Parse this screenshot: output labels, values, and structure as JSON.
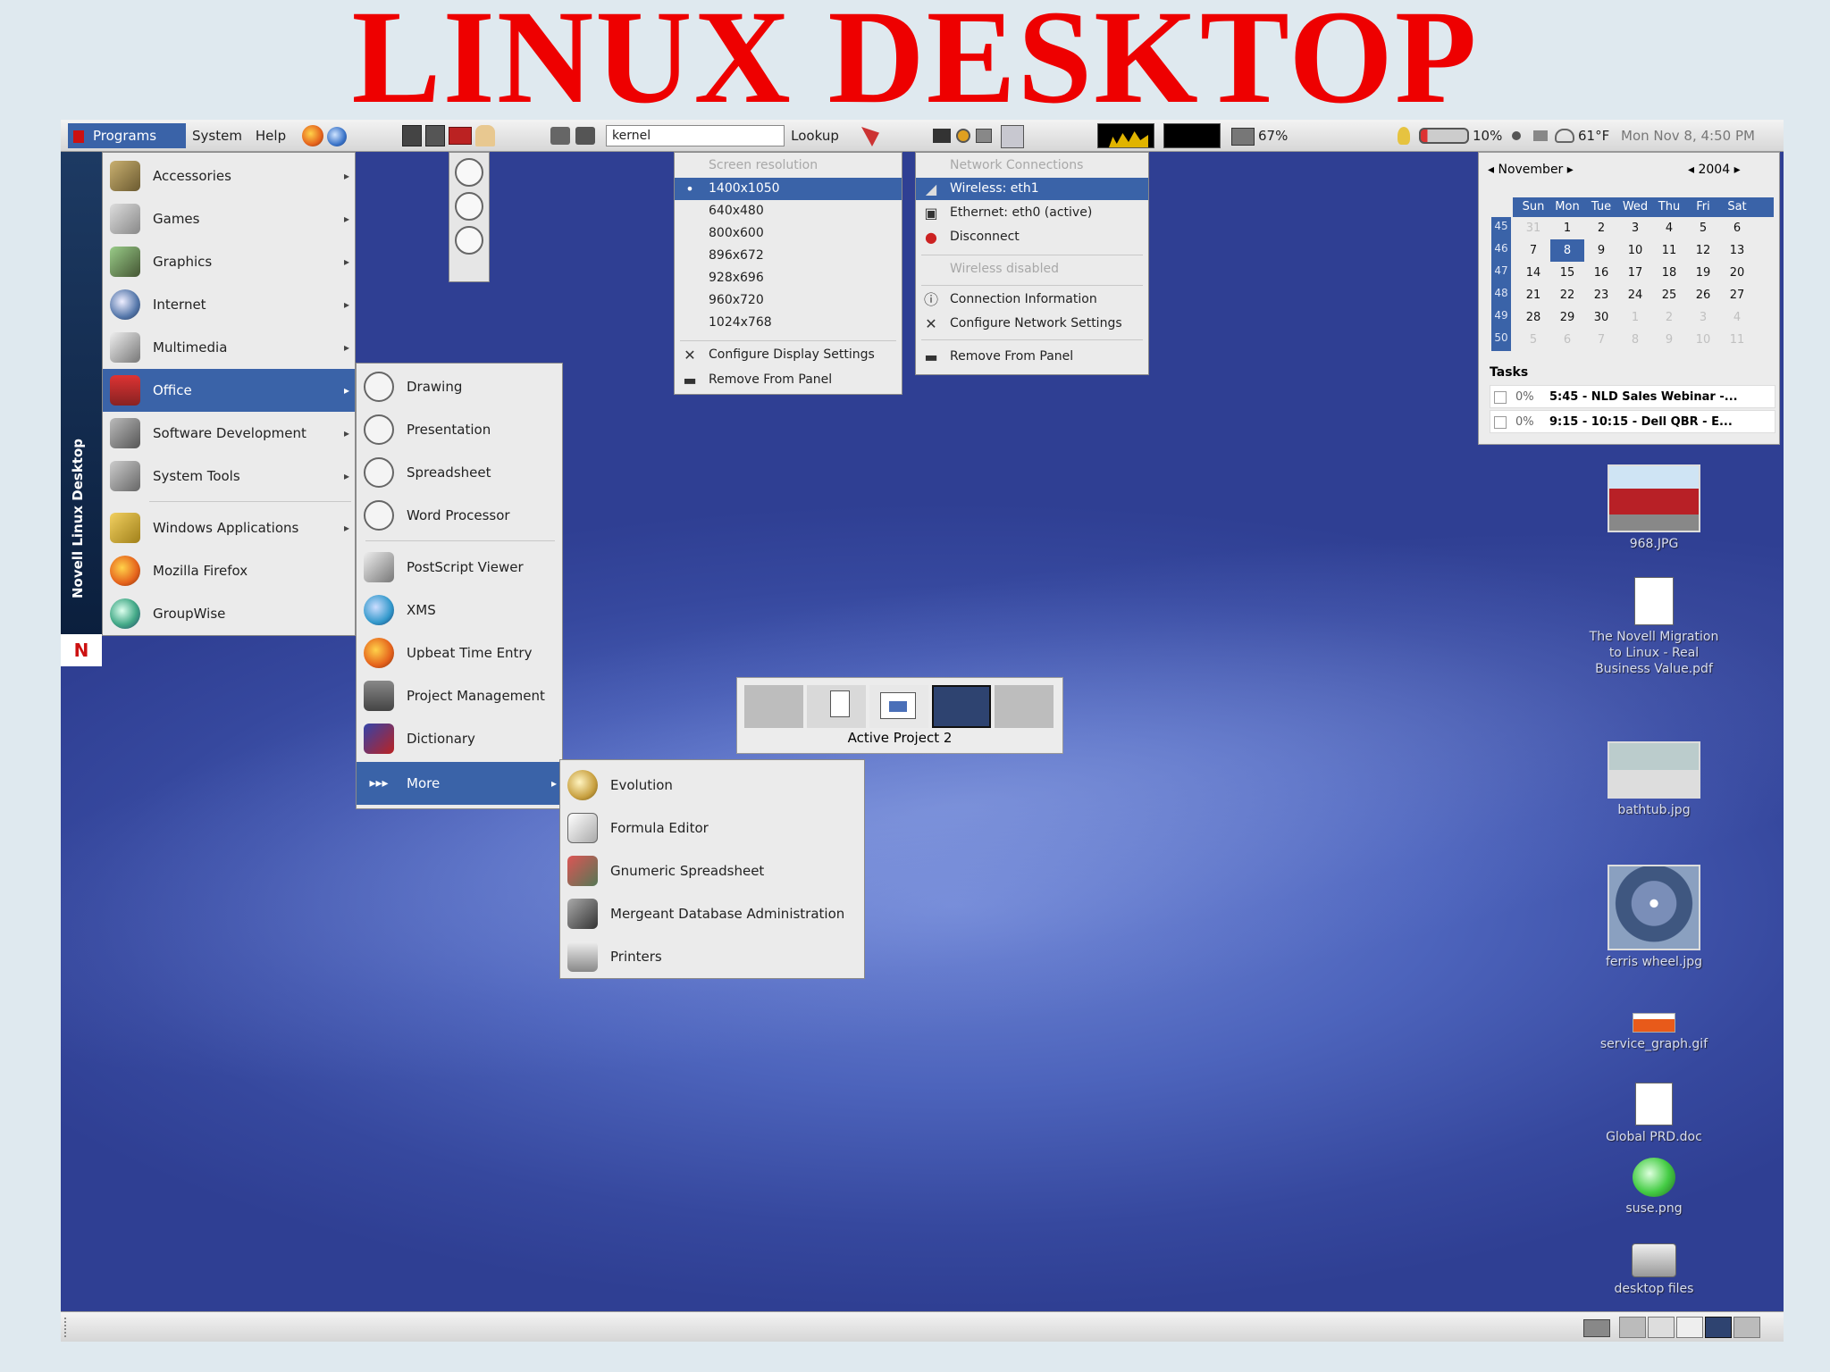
{
  "slide": {
    "title": "LINUX DESKTOP"
  },
  "panel": {
    "programs": "Programs",
    "system": "System",
    "help": "Help",
    "command_value": "kernel",
    "lookup": "Lookup",
    "usage_percent": "67%",
    "battery_percent": "10%",
    "temperature": "61°F",
    "clock": "Mon Nov  8,  4:50 PM"
  },
  "sidebar": {
    "brand": "Novell Linux Desktop",
    "logo": "N"
  },
  "programs_menu": {
    "items": [
      {
        "label": "Accessories",
        "icon": "accessories-icon"
      },
      {
        "label": "Games",
        "icon": "games-icon"
      },
      {
        "label": "Graphics",
        "icon": "graphics-icon"
      },
      {
        "label": "Internet",
        "icon": "internet-icon"
      },
      {
        "label": "Multimedia",
        "icon": "multimedia-icon"
      },
      {
        "label": "Office",
        "icon": "office-icon"
      },
      {
        "label": "Software Development",
        "icon": "software-development-icon"
      },
      {
        "label": "System Tools",
        "icon": "system-tools-icon"
      },
      {
        "label": "Windows Applications",
        "icon": "windows-applications-icon"
      },
      {
        "label": "Mozilla Firefox",
        "icon": "firefox-icon"
      },
      {
        "label": "GroupWise",
        "icon": "groupwise-icon"
      }
    ]
  },
  "office_menu": {
    "items": [
      {
        "label": "Drawing"
      },
      {
        "label": "Presentation"
      },
      {
        "label": "Spreadsheet"
      },
      {
        "label": "Word Processor"
      },
      {
        "label": "PostScript Viewer"
      },
      {
        "label": "XMS"
      },
      {
        "label": "Upbeat Time Entry"
      },
      {
        "label": "Project Management"
      },
      {
        "label": "Dictionary"
      },
      {
        "label": "More"
      }
    ]
  },
  "more_menu": {
    "items": [
      {
        "label": "Evolution"
      },
      {
        "label": "Formula Editor"
      },
      {
        "label": "Gnumeric Spreadsheet"
      },
      {
        "label": "Mergeant Database Administration"
      },
      {
        "label": "Printers"
      }
    ]
  },
  "resolution_menu": {
    "header": "Screen resolution",
    "options": [
      "1400x1050",
      "640x480",
      "800x600",
      "896x672",
      "928x696",
      "960x720",
      "1024x768"
    ],
    "selected": "1400x1050",
    "configure": "Configure Display Settings",
    "remove": "Remove From Panel"
  },
  "network_menu": {
    "header": "Network Connections",
    "wireless": "Wireless: eth1",
    "ethernet": "Ethernet: eth0 (active)",
    "disconnect": "Disconnect",
    "wireless_disabled": "Wireless disabled",
    "connection_info": "Connection Information",
    "configure": "Configure Network Settings",
    "remove": "Remove From Panel"
  },
  "calendar": {
    "month": "November",
    "year": "2004",
    "weekdays": [
      "Sun",
      "Mon",
      "Tue",
      "Wed",
      "Thu",
      "Fri",
      "Sat"
    ],
    "weeks": [
      "45",
      "46",
      "47",
      "48",
      "49",
      "50"
    ],
    "rows": [
      [
        "31",
        "1",
        "2",
        "3",
        "4",
        "5",
        "6"
      ],
      [
        "7",
        "8",
        "9",
        "10",
        "11",
        "12",
        "13"
      ],
      [
        "14",
        "15",
        "16",
        "17",
        "18",
        "19",
        "20"
      ],
      [
        "21",
        "22",
        "23",
        "24",
        "25",
        "26",
        "27"
      ],
      [
        "28",
        "29",
        "30",
        "1",
        "2",
        "3",
        "4"
      ],
      [
        "5",
        "6",
        "7",
        "8",
        "9",
        "10",
        "11"
      ]
    ],
    "today": "8",
    "tasks_title": "Tasks",
    "tasks": [
      {
        "pct": "0%",
        "text": "5:45 - NLD Sales Webinar -..."
      },
      {
        "pct": "0%",
        "text": "9:15 - 10:15 - Dell QBR - E..."
      }
    ]
  },
  "workspace": {
    "label": "Active Project 2"
  },
  "desktop_icons": [
    {
      "label": "968.JPG",
      "icon": "photo-icon"
    },
    {
      "label": "The Novell Migration to Linux - Real Business Value.pdf",
      "icon": "pdf-icon"
    },
    {
      "label": "bathtub.jpg",
      "icon": "photo-icon"
    },
    {
      "label": "ferris wheel.jpg",
      "icon": "photo-icon"
    },
    {
      "label": "service_graph.gif",
      "icon": "graph-icon"
    },
    {
      "label": "Global PRD.doc",
      "icon": "document-icon"
    },
    {
      "label": "suse.png",
      "icon": "suse-icon"
    },
    {
      "label": "desktop files",
      "icon": "folder-icon"
    }
  ],
  "colors": {
    "title_red": "#ee0000",
    "selection_blue": "#3a63a8",
    "desktop_blue": "#3c50a8"
  }
}
